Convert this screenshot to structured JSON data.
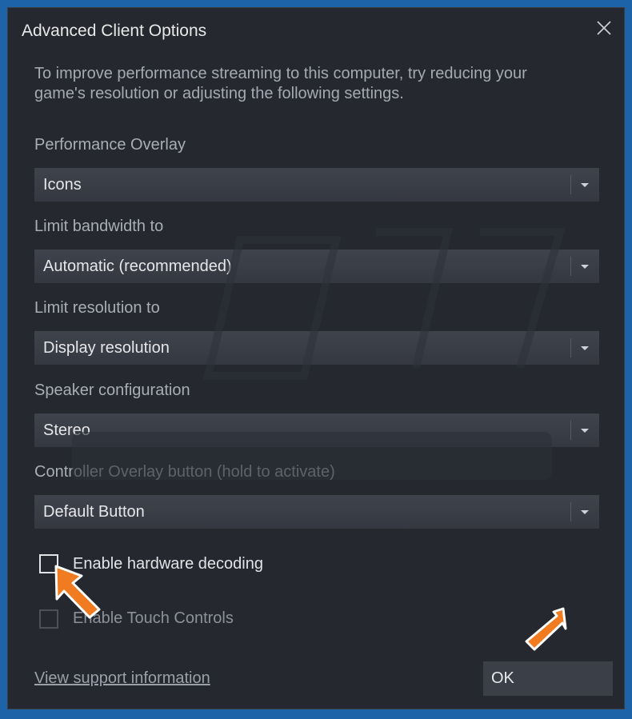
{
  "dialog": {
    "title": "Advanced Client Options",
    "close_icon": "close-icon",
    "description": "To improve performance streaming to this computer, try reducing your game's resolution or adjusting the following settings."
  },
  "settings": [
    {
      "label": "Performance Overlay",
      "value": "Icons"
    },
    {
      "label": "Limit bandwidth to",
      "value": "Automatic (recommended)"
    },
    {
      "label": "Limit resolution to",
      "value": "Display resolution"
    },
    {
      "label": "Speaker configuration",
      "value": "Stereo"
    },
    {
      "label": "Controller Overlay button (hold to activate)",
      "value": "Default Button"
    }
  ],
  "checkboxes": [
    {
      "label": "Enable hardware decoding",
      "checked": false,
      "enabled": true
    },
    {
      "label": "Enable Touch Controls",
      "checked": false,
      "enabled": false
    }
  ],
  "footer": {
    "support_link": "View support information",
    "ok_label": "OK"
  },
  "colors": {
    "background": "#1c63a8",
    "dialog": "#25282e",
    "dropdown": "#3b3f47",
    "annotation_arrow": "#f07b21"
  }
}
